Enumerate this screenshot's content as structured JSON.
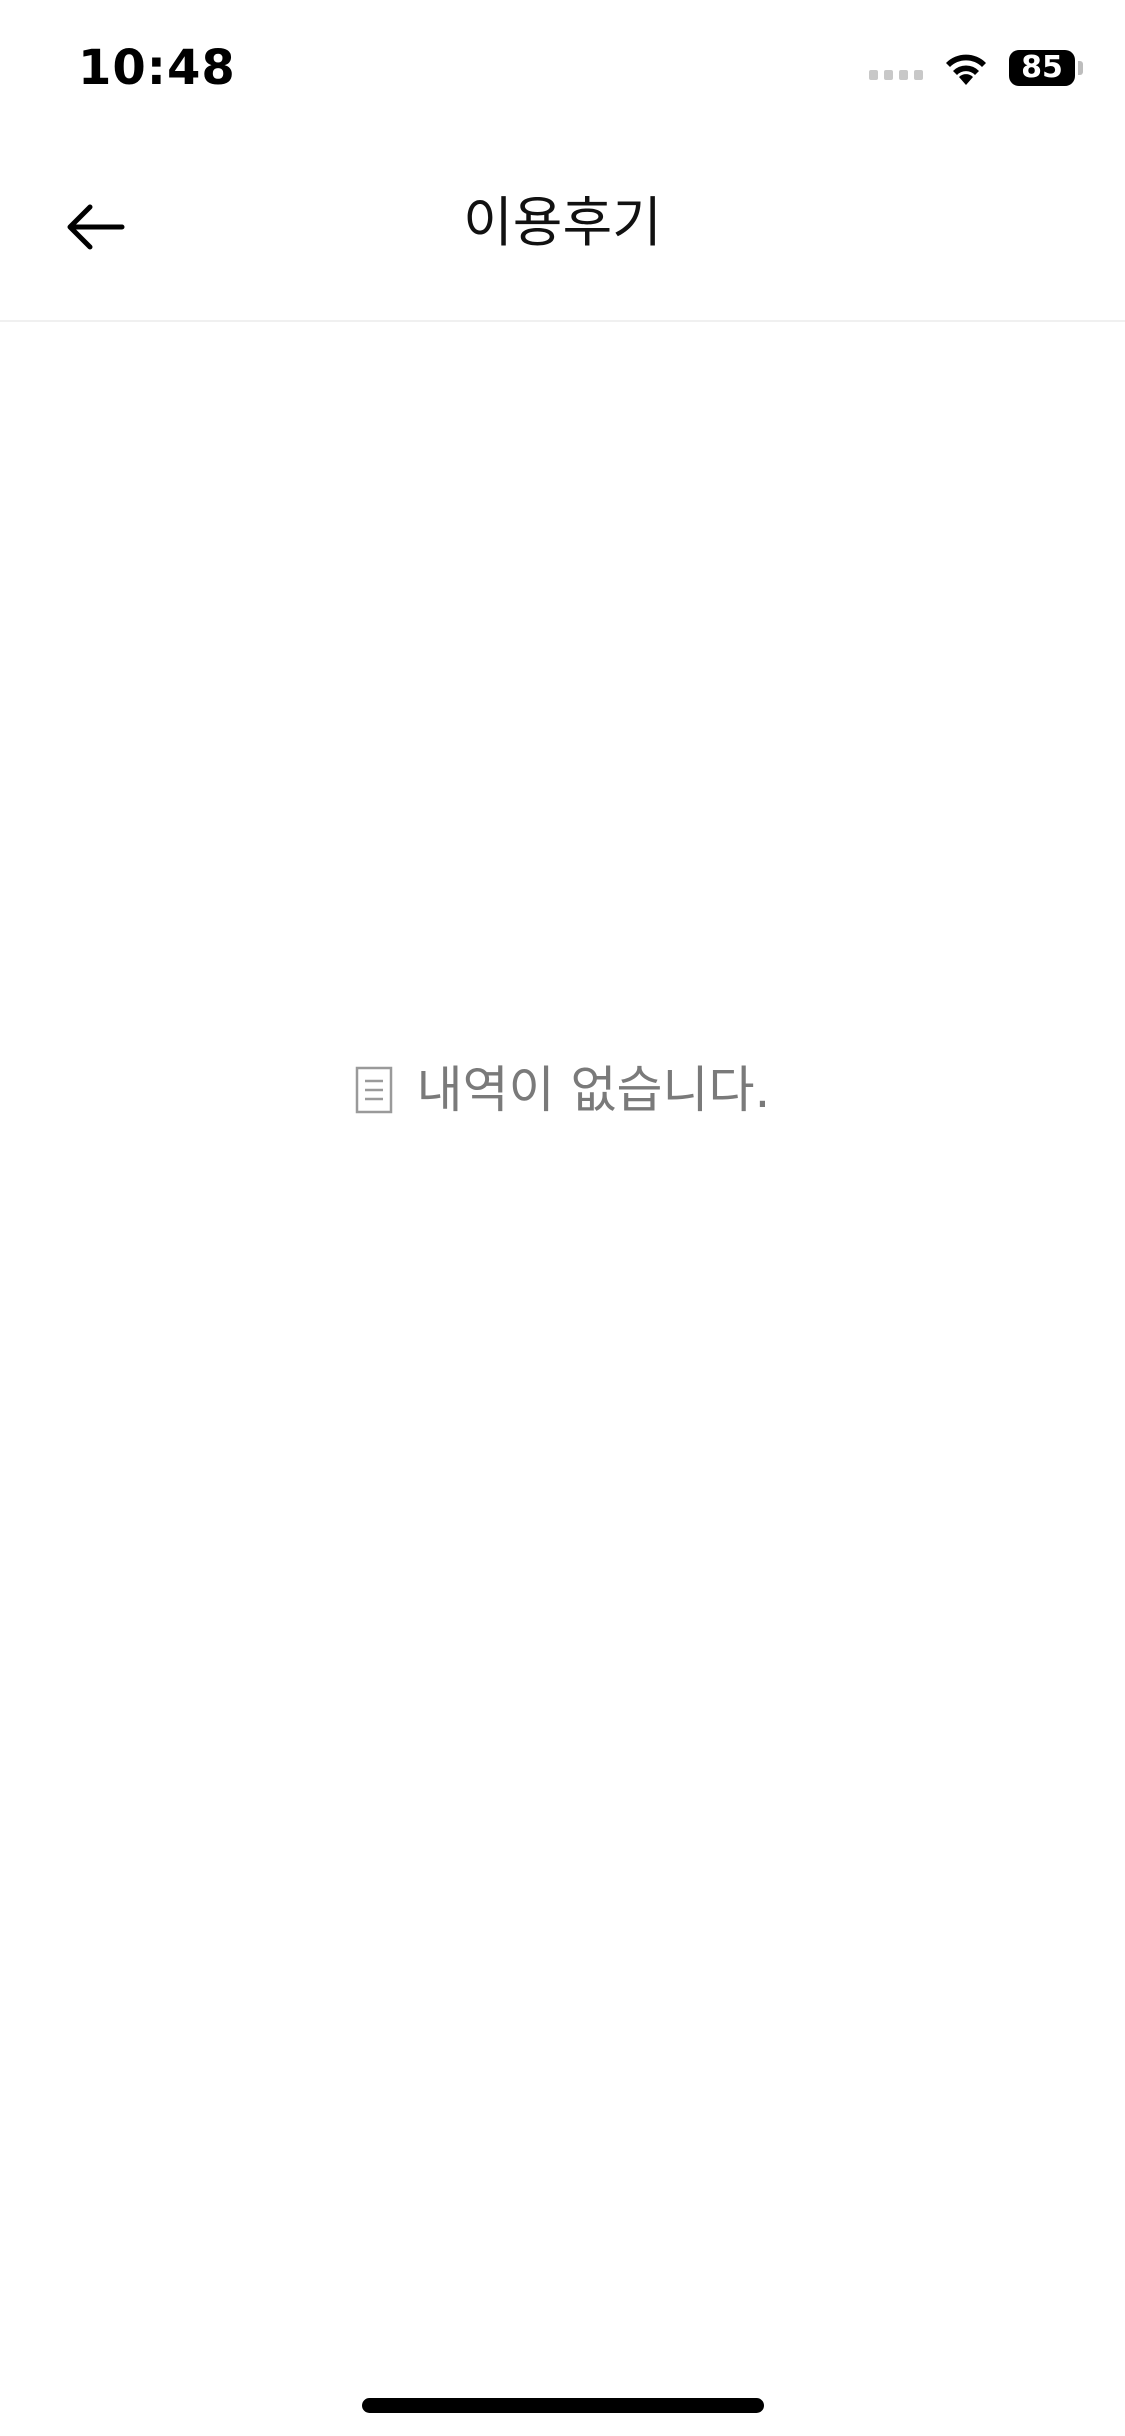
{
  "status_bar": {
    "time": "10:48",
    "battery": "85"
  },
  "header": {
    "title": "이용후기",
    "back_icon": "arrow-left-icon"
  },
  "empty_state": {
    "icon": "document-icon",
    "message": "내역이 없습니다."
  }
}
